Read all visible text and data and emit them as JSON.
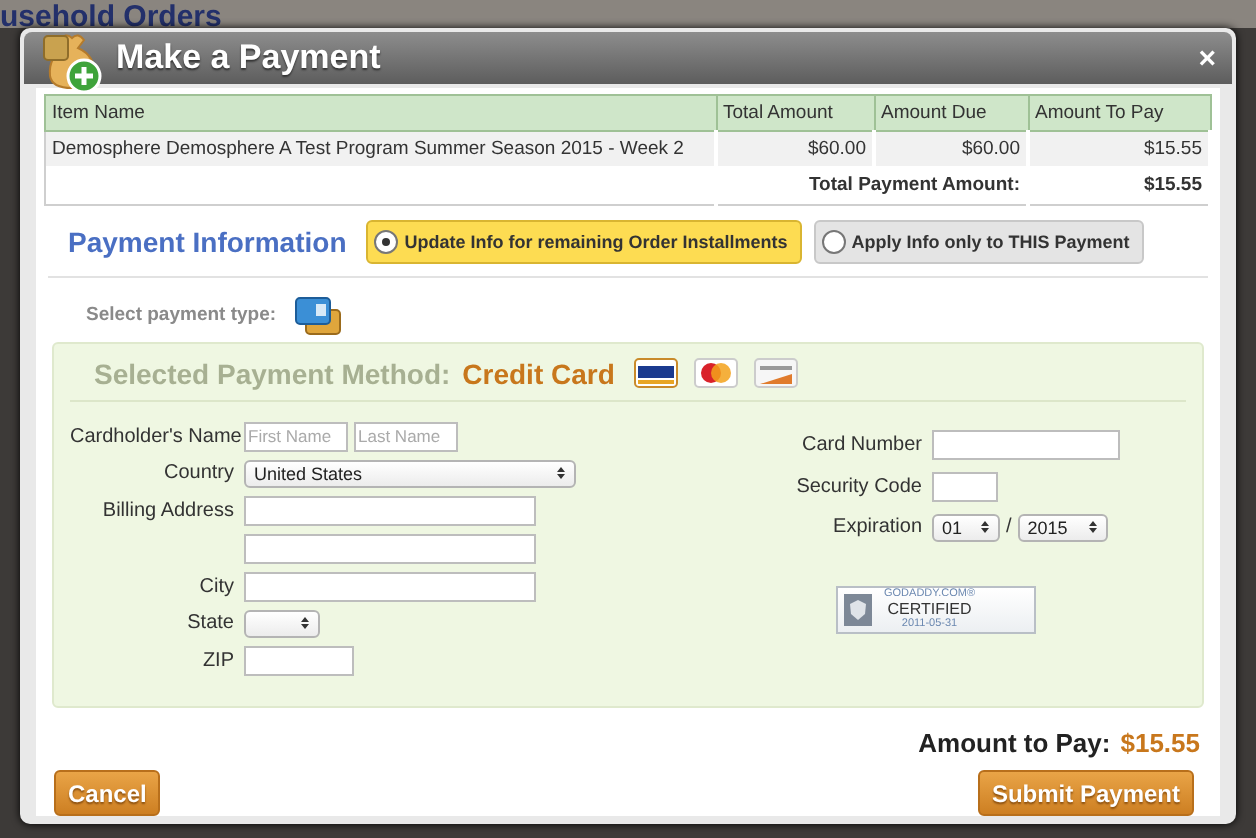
{
  "background": {
    "heading": "usehold Orders"
  },
  "dialog": {
    "title": "Make a Payment",
    "close": "×"
  },
  "table": {
    "columns": [
      "Item Name",
      "Total Amount",
      "Amount Due",
      "Amount To Pay"
    ],
    "rows": [
      [
        "Demosphere Demosphere A Test Program Summer Season 2015 - Week 2",
        "$60.00",
        "$60.00",
        "$15.55"
      ]
    ],
    "total_label": "Total Payment Amount:",
    "total_value": "$15.55"
  },
  "payment_info": {
    "heading": "Payment Information",
    "options": [
      {
        "label": "Update Info for remaining Order Installments",
        "selected": true
      },
      {
        "label": "Apply Info only to THIS Payment",
        "selected": false
      }
    ]
  },
  "payment_type": {
    "label": "Select payment type:"
  },
  "method": {
    "label": "Selected Payment Method:",
    "value": "Credit Card"
  },
  "left_fields": [
    {
      "kind": "name",
      "label": "Cardholder's Name",
      "first_placeholder": "First Name",
      "last_placeholder": "Last Name"
    },
    {
      "kind": "select-wide",
      "label": "Country",
      "value": "United States"
    },
    {
      "kind": "text-long",
      "label": "Billing Address"
    },
    {
      "kind": "text-long"
    },
    {
      "kind": "text-long",
      "label": "City"
    },
    {
      "kind": "select-narrow",
      "label": "State"
    },
    {
      "kind": "text-short",
      "label": "ZIP"
    }
  ],
  "right_fields": [
    {
      "kind": "text-medium",
      "label": "Card Number"
    },
    {
      "kind": "text-tiny",
      "label": "Security Code"
    },
    {
      "kind": "expiry",
      "label": "Expiration",
      "month": "01",
      "separator": "/",
      "year": "2015"
    }
  ],
  "seal": {
    "brand": "GODADDY.COM®",
    "title": "CERTIFIED",
    "date": "2011-05-31"
  },
  "amount": {
    "label": "Amount to Pay:",
    "value": "$15.55"
  },
  "buttons": [
    {
      "label": "Cancel"
    },
    {
      "label": "Submit Payment"
    }
  ]
}
